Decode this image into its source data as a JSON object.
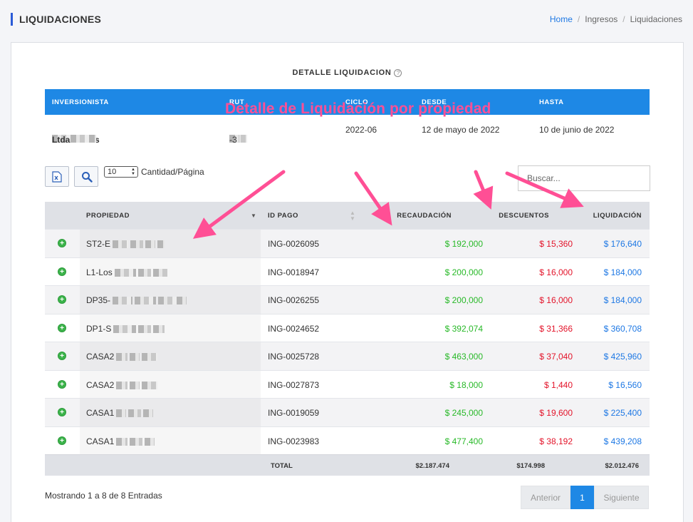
{
  "header": {
    "title": "LIQUIDACIONES",
    "breadcrumb": [
      "Home",
      "Ingresos",
      "Liquidaciones"
    ]
  },
  "detail": {
    "title": "DETALLE LIQUIDACION",
    "help_icon": "?",
    "columns": [
      "INVERSIONISTA",
      "RUT",
      "CICLO",
      "DESDE",
      "HASTA"
    ],
    "investor_prefix": "Inversiones",
    "investor_suffix": "Ltda",
    "rut_prefix": "76",
    "rut_suffix": "-3",
    "ciclo": "2022-06",
    "desde": "12 de mayo de 2022",
    "hasta": "10 de junio de 2022"
  },
  "annotation": "Detalle de Liquidación por propiedad",
  "toolbar": {
    "excel_icon": "excel-icon",
    "search_icon": "search-icon",
    "page_size": "10",
    "page_size_label": "Cantidad/Página",
    "search_placeholder": "Buscar..."
  },
  "table": {
    "columns": [
      "PROPIEDAD",
      "ID PAGO",
      "RECAUDACIÓN",
      "DESCUENTOS",
      "LIQUIDACIÓN"
    ],
    "rows": [
      {
        "propiedad": "ST2-E",
        "id_pago": "ING-0026095",
        "recaudacion": "$ 192,000",
        "descuentos": "$ 15,360",
        "liquidacion": "$ 176,640"
      },
      {
        "propiedad": "L1-Los",
        "id_pago": "ING-0018947",
        "recaudacion": "$ 200,000",
        "descuentos": "$ 16,000",
        "liquidacion": "$ 184,000"
      },
      {
        "propiedad": "DP35-",
        "id_pago": "ING-0026255",
        "recaudacion": "$ 200,000",
        "descuentos": "$ 16,000",
        "liquidacion": "$ 184,000"
      },
      {
        "propiedad": "DP1-S",
        "id_pago": "ING-0024652",
        "recaudacion": "$ 392,074",
        "descuentos": "$ 31,366",
        "liquidacion": "$ 360,708"
      },
      {
        "propiedad": "CASA2",
        "id_pago": "ING-0025728",
        "recaudacion": "$ 463,000",
        "descuentos": "$ 37,040",
        "liquidacion": "$ 425,960"
      },
      {
        "propiedad": "CASA2",
        "id_pago": "ING-0027873",
        "recaudacion": "$ 18,000",
        "descuentos": "$ 1,440",
        "liquidacion": "$ 16,560"
      },
      {
        "propiedad": "CASA1",
        "id_pago": "ING-0019059",
        "recaudacion": "$ 245,000",
        "descuentos": "$ 19,600",
        "liquidacion": "$ 225,400"
      },
      {
        "propiedad": "CASA1",
        "id_pago": "ING-0023983",
        "recaudacion": "$ 477,400",
        "descuentos": "$ 38,192",
        "liquidacion": "$ 439,208"
      }
    ],
    "total_label": "TOTAL",
    "total_recaudacion": "$2.187.474",
    "total_descuentos": "$174.998",
    "total_liquidacion": "$2.012.476"
  },
  "footer": {
    "showing": "Mostrando 1 a 8 de 8 Entradas",
    "prev": "Anterior",
    "page": "1",
    "next": "Siguiente"
  },
  "colors": {
    "accent": "#1e88e5",
    "positive": "#28b928",
    "negative": "#e3142a",
    "link": "#1e78e4",
    "annotation": "#ff4f95"
  }
}
